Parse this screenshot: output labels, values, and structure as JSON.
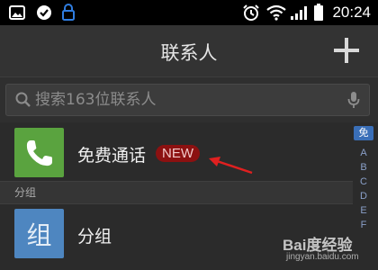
{
  "status_bar": {
    "time": "20:24",
    "left_icons": [
      "gallery-icon",
      "check-circle-icon",
      "lock-icon"
    ],
    "right_icons": [
      "alarm-icon",
      "wifi-icon",
      "signal-icon",
      "battery-icon"
    ]
  },
  "header": {
    "title": "联系人",
    "add_icon": "plus-icon"
  },
  "search": {
    "placeholder": "搜索163位联系人",
    "search_icon": "magnifier-icon",
    "voice_icon": "microphone-icon"
  },
  "list": {
    "free_call": {
      "label": "免费通话",
      "badge": "NEW",
      "avatar_color": "#5aa33f",
      "icon": "phone-icon"
    },
    "section_label": "分组",
    "group_row": {
      "label": "分组",
      "avatar_char": "组",
      "avatar_color": "#4e86c0"
    }
  },
  "index_bar": {
    "items": [
      "免",
      "A",
      "B",
      "C",
      "D",
      "E",
      "F"
    ]
  },
  "annotation": {
    "arrow_color": "#e02020"
  },
  "watermark": {
    "logo": "Bai度经验",
    "url": "jingyan.baidu.com"
  }
}
